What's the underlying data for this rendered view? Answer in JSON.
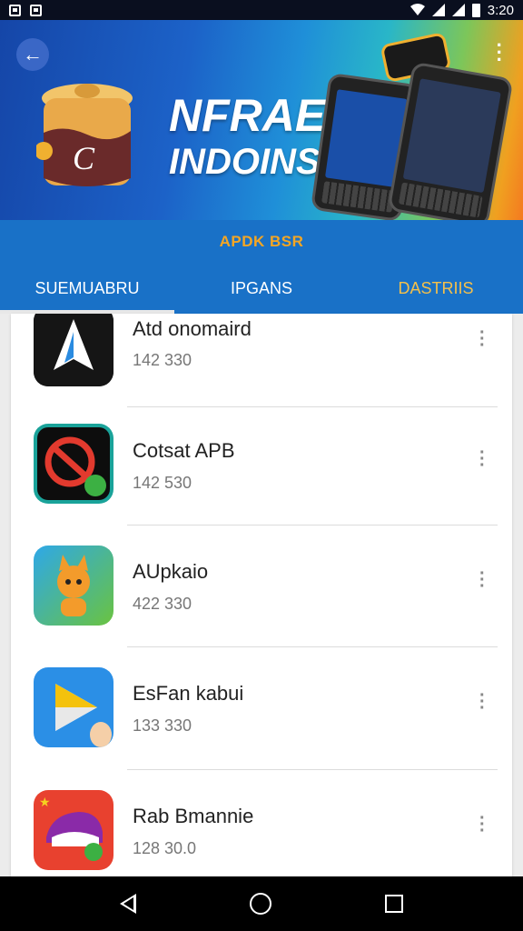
{
  "status": {
    "time": "3:20"
  },
  "banner": {
    "headline_line1": "NFRAEAEA",
    "headline_line2": "INDOINSIA"
  },
  "subbar": {
    "label": "APDK BSR"
  },
  "tabs": [
    {
      "label": "SUEMUABRU",
      "active": true
    },
    {
      "label": "IPGANS",
      "active": false
    },
    {
      "label": "DASTRIIS",
      "active": false
    }
  ],
  "apps": [
    {
      "name": "Atd onomaird",
      "meta": "142 330",
      "icon": "arrow-app-icon"
    },
    {
      "name": "Cotsat APB",
      "meta": "142 530",
      "icon": "no-sign-app-icon"
    },
    {
      "name": "AUpkaio",
      "meta": "422 330",
      "icon": "fox-app-icon"
    },
    {
      "name": "EsFan kabui",
      "meta": "133 330",
      "icon": "play-app-icon"
    },
    {
      "name": "Rab Bmannie",
      "meta": "128 30.0",
      "icon": "car-app-icon"
    }
  ],
  "colors": {
    "tab_bar": "#1971c7",
    "accent_gold": "#f5a623"
  }
}
